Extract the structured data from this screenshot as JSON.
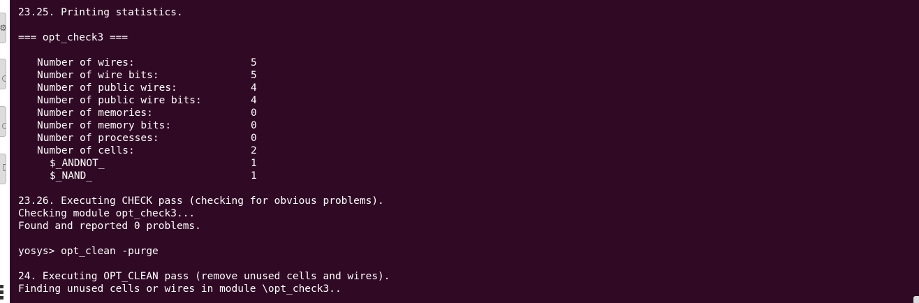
{
  "dock": {
    "icons": [
      "settings-app-icon",
      "disk-app-icon",
      "drive-app-icon",
      "document-app-icon"
    ],
    "grid_icon": "show-apps-icon"
  },
  "terminal": {
    "lines_before": [
      "23.25. Printing statistics.",
      "",
      "=== opt_check3 ===",
      ""
    ],
    "stats": [
      {
        "label": "Number of wires:",
        "value": "5",
        "sub": false
      },
      {
        "label": "Number of wire bits:",
        "value": "5",
        "sub": false
      },
      {
        "label": "Number of public wires:",
        "value": "4",
        "sub": false
      },
      {
        "label": "Number of public wire bits:",
        "value": "4",
        "sub": false
      },
      {
        "label": "Number of memories:",
        "value": "0",
        "sub": false
      },
      {
        "label": "Number of memory bits:",
        "value": "0",
        "sub": false
      },
      {
        "label": "Number of processes:",
        "value": "0",
        "sub": false
      },
      {
        "label": "Number of cells:",
        "value": "2",
        "sub": false
      },
      {
        "label": "$_ANDNOT_",
        "value": "1",
        "sub": true
      },
      {
        "label": "$_NAND_",
        "value": "1",
        "sub": true
      }
    ],
    "lines_after": [
      "",
      "23.26. Executing CHECK pass (checking for obvious problems).",
      "Checking module opt_check3...",
      "Found and reported 0 problems.",
      "",
      "yosys> opt_clean -purge",
      "",
      "24. Executing OPT_CLEAN pass (remove unused cells and wires).",
      "Finding unused cells or wires in module \\opt_check3.."
    ],
    "colors": {
      "background": "#300a24",
      "foreground": "#ffffff"
    }
  }
}
